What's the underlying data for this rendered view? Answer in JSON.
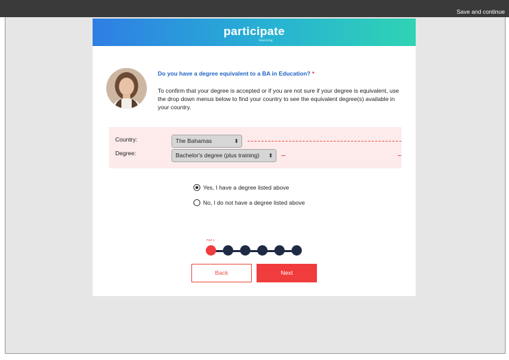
{
  "topbar": {
    "save_label": "Save and continue"
  },
  "header": {
    "logo_text": "participate",
    "logo_subtext": "learning"
  },
  "question": {
    "title": "Do you have a degree equivalent to a BA in Education?",
    "required_mark": "*",
    "description": "To confirm that your degree is accepted or if you are not sure if your degree is equivalent, use the drop down menus below to find your country to see the equivalent degree(s) available in your country."
  },
  "fields": {
    "country_label": "Country:",
    "country_value": "The Bahamas",
    "degree_label": "Degree:",
    "degree_value": "Bachelor's degree (plus training)"
  },
  "options": [
    {
      "label": "Yes, I have a degree listed above",
      "selected": true
    },
    {
      "label": "No, I do not have a degree listed above",
      "selected": false
    }
  ],
  "progress": {
    "current_label": "Part 1",
    "total_steps": 6,
    "current_step": 1
  },
  "buttons": {
    "back": "Back",
    "next": "Next"
  },
  "colors": {
    "accent": "#f03c3c",
    "link_blue": "#1f63c6",
    "dark_navy": "#1f2a44",
    "panel_pink": "#fdeaea"
  }
}
